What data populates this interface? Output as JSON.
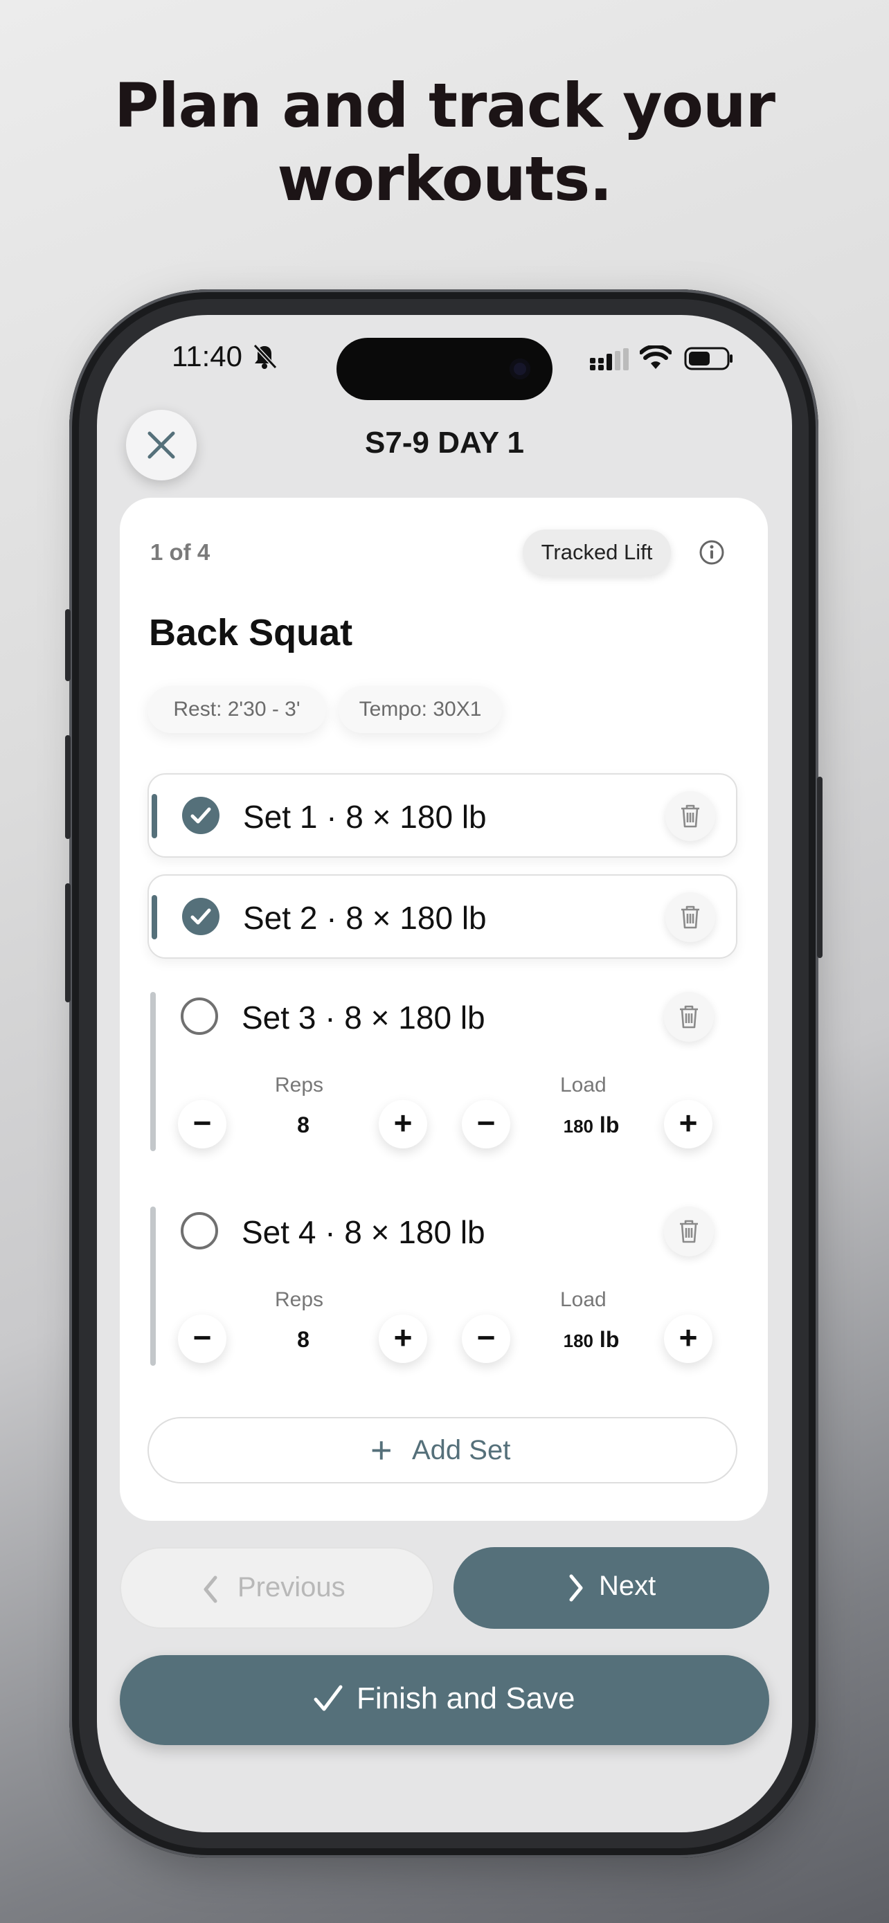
{
  "headline": {
    "line1": "Plan and track your",
    "line2": "workouts."
  },
  "status_bar": {
    "time": "11:40"
  },
  "header": {
    "title": "S7-9 DAY 1"
  },
  "card": {
    "counter": "1 of 4",
    "badge": "Tracked Lift",
    "exercise": "Back Squat",
    "rest": "Rest: 2'30 - 3'",
    "tempo": "Tempo: 30X1",
    "sets": [
      {
        "label": "Set 1 · 8 × 180 lb",
        "done": true
      },
      {
        "label": "Set 2 · 8 × 180 lb",
        "done": true
      },
      {
        "label": "Set 3 · 8 × 180 lb",
        "done": false,
        "reps_label": "Reps",
        "reps": "8",
        "load_label": "Load",
        "load_value": "180",
        "load_unit": "lb"
      },
      {
        "label": "Set 4 · 8 × 180 lb",
        "done": false,
        "reps_label": "Reps",
        "reps": "8",
        "load_label": "Load",
        "load_value": "180",
        "load_unit": "lb"
      }
    ],
    "add_set": "Add Set",
    "minus": "−",
    "plus": "+"
  },
  "nav": {
    "previous": "Previous",
    "next": "Next",
    "finish": "Finish and Save"
  },
  "colors": {
    "accent": "#55707a",
    "background": "#e5e5e6",
    "card": "#ffffff"
  },
  "icons": [
    "close-icon",
    "bell-slash-icon",
    "signal-icon",
    "wifi-icon",
    "battery-icon",
    "info-icon",
    "checkmark-icon",
    "trash-icon",
    "plus-icon",
    "chevron-left-icon",
    "chevron-right-icon"
  ]
}
